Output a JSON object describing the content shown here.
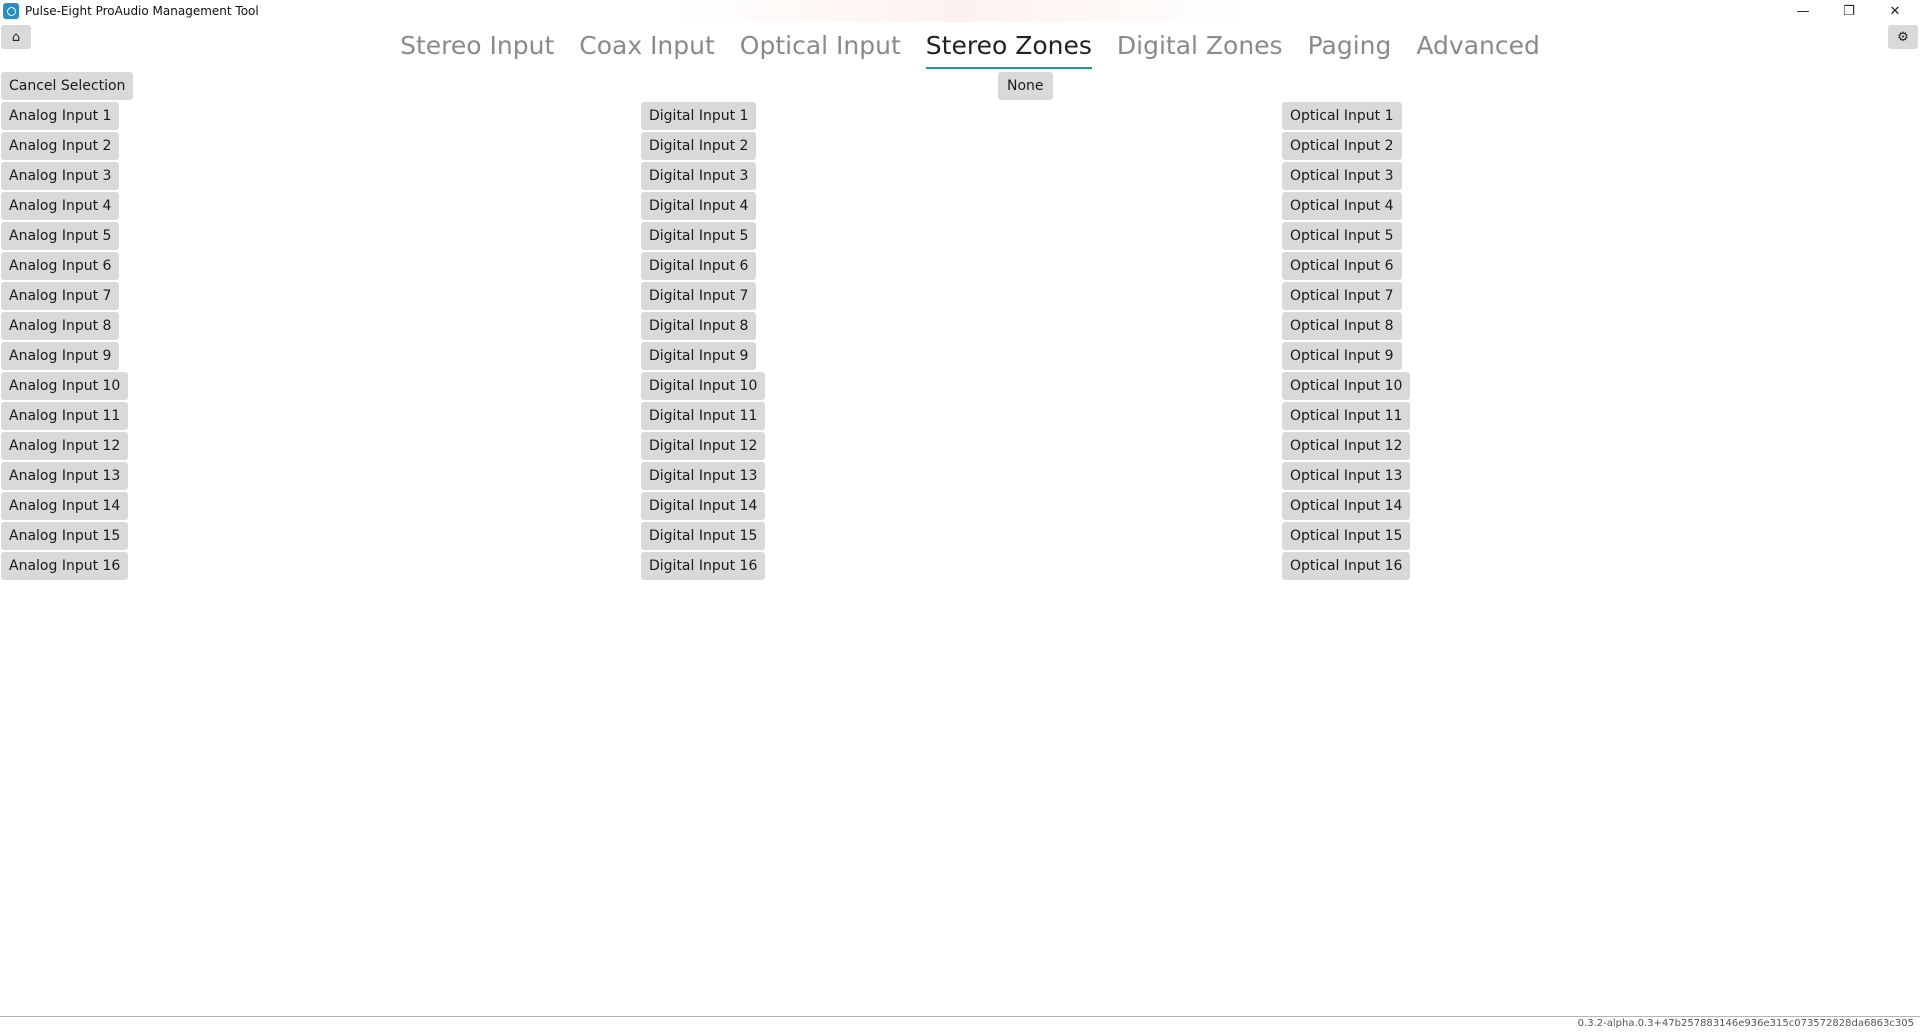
{
  "window": {
    "title": "Pulse-Eight ProAudio Management Tool",
    "minimize_glyph": "—",
    "maximize_glyph": "❐",
    "close_glyph": "✕"
  },
  "toolbar": {
    "home_icon": "⌂",
    "settings_icon": "⚙"
  },
  "tabs": [
    {
      "label": "Stereo Input",
      "active": false
    },
    {
      "label": "Coax Input",
      "active": false
    },
    {
      "label": "Optical Input",
      "active": false
    },
    {
      "label": "Stereo Zones",
      "active": true
    },
    {
      "label": "Digital Zones",
      "active": false
    },
    {
      "label": "Paging",
      "active": false
    },
    {
      "label": "Advanced",
      "active": false
    }
  ],
  "actions": {
    "cancel_label": "Cancel Selection",
    "none_label": "None"
  },
  "analog_inputs": [
    "Analog Input 1",
    "Analog Input 2",
    "Analog Input 3",
    "Analog Input 4",
    "Analog Input 5",
    "Analog Input 6",
    "Analog Input 7",
    "Analog Input 8",
    "Analog Input 9",
    "Analog Input 10",
    "Analog Input 11",
    "Analog Input 12",
    "Analog Input 13",
    "Analog Input 14",
    "Analog Input 15",
    "Analog Input 16"
  ],
  "digital_inputs": [
    "Digital Input 1",
    "Digital Input 2",
    "Digital Input 3",
    "Digital Input 4",
    "Digital Input 5",
    "Digital Input 6",
    "Digital Input 7",
    "Digital Input 8",
    "Digital Input 9",
    "Digital Input 10",
    "Digital Input 11",
    "Digital Input 12",
    "Digital Input 13",
    "Digital Input 14",
    "Digital Input 15",
    "Digital Input 16"
  ],
  "optical_inputs": [
    "Optical Input 1",
    "Optical Input 2",
    "Optical Input 3",
    "Optical Input 4",
    "Optical Input 5",
    "Optical Input 6",
    "Optical Input 7",
    "Optical Input 8",
    "Optical Input 9",
    "Optical Input 10",
    "Optical Input 11",
    "Optical Input 12",
    "Optical Input 13",
    "Optical Input 14",
    "Optical Input 15",
    "Optical Input 16"
  ],
  "footer": {
    "version": "0.3.2-alpha.0.3+47b257883146e936e315c073572828da6863c305"
  },
  "colors": {
    "accent": "#1e9a9a",
    "button_bg": "#d9d9d9",
    "tab_inactive": "#8a8a8a"
  }
}
